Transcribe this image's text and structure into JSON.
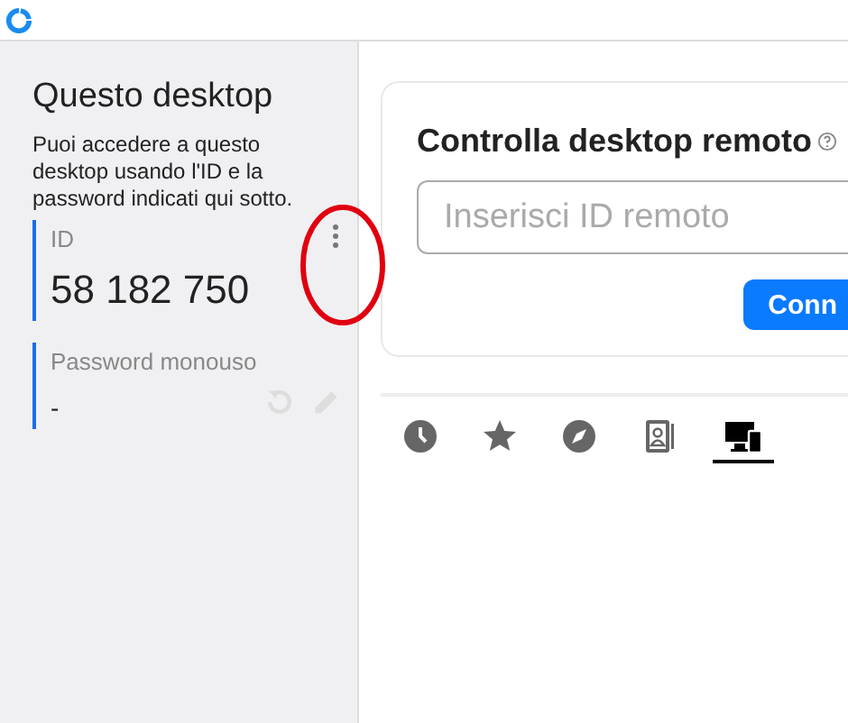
{
  "sidebar": {
    "title": "Questo desktop",
    "description": "Puoi accedere a questo desktop usando l'ID e la password indicati qui sotto.",
    "id_label": "ID",
    "id_value": "58 182 750",
    "password_label": "Password monouso",
    "password_value": "-"
  },
  "connect": {
    "title": "Controlla desktop remoto",
    "placeholder": "Inserisci ID remoto",
    "button": "Conn"
  },
  "tabs": [
    {
      "kind": "recent",
      "selected": false
    },
    {
      "kind": "favorites",
      "selected": false
    },
    {
      "kind": "discovered",
      "selected": false
    },
    {
      "kind": "addressbook",
      "selected": false
    },
    {
      "kind": "devices",
      "selected": true
    }
  ]
}
